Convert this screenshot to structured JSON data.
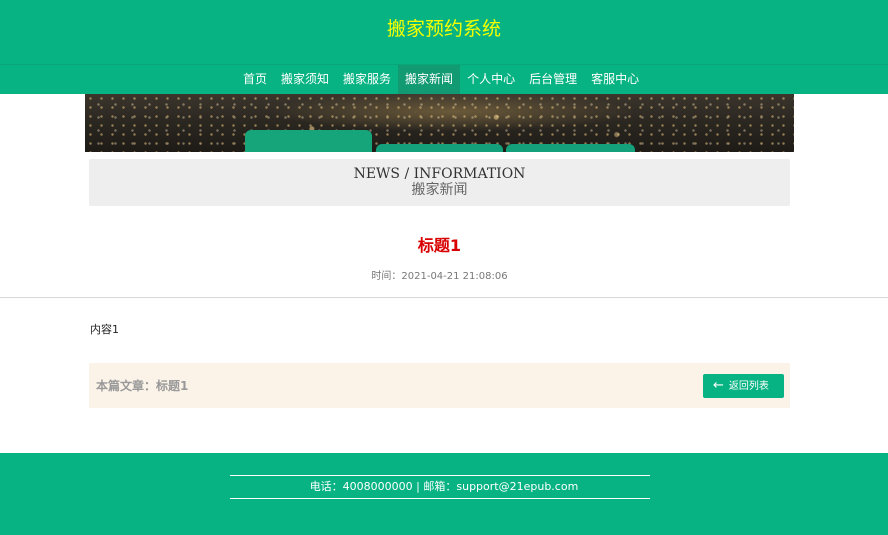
{
  "header": {
    "title": "搬家预约系统"
  },
  "nav": {
    "items": [
      {
        "label": "首页",
        "active": false
      },
      {
        "label": "搬家须知",
        "active": false
      },
      {
        "label": "搬家服务",
        "active": false
      },
      {
        "label": "搬家新闻",
        "active": true
      },
      {
        "label": "个人中心",
        "active": false
      },
      {
        "label": "后台管理",
        "active": false
      },
      {
        "label": "客服中心",
        "active": false
      }
    ]
  },
  "section": {
    "en": "NEWS / INFORMATION",
    "cn": "搬家新闻"
  },
  "article": {
    "title": "标题1",
    "time": "时间：2021-04-21 21:08:06",
    "body": "内容1",
    "current_label": "本篇文章：标题1",
    "back_icon": "arrow-left-icon",
    "back_label": "返回列表"
  },
  "footer": {
    "contact": "电话：4008000000 | 邮箱：support@21epub.com"
  },
  "colors": {
    "brand": "#07b382",
    "title_yellow": "#f5ff00",
    "article_title": "#d80000",
    "nav_active": "#129a72",
    "article_bar": "#fbf3e8"
  }
}
